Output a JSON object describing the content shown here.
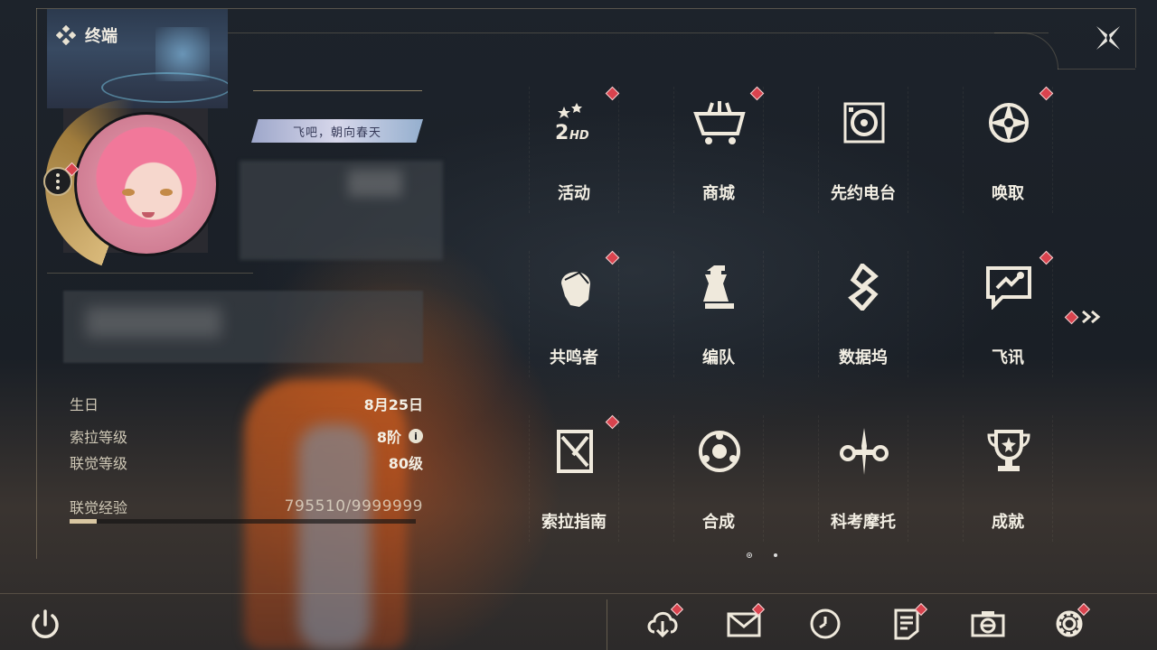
{
  "header": {
    "title": "终端"
  },
  "profile": {
    "signature": "飞吧，朝向春天",
    "info": [
      {
        "label": "生日",
        "value": "8月25日"
      },
      {
        "label": "索拉等级",
        "value": "8阶"
      },
      {
        "label": "联觉等级",
        "value": "80级"
      }
    ],
    "exp": {
      "label": "联觉经验",
      "value": "795510/9999999",
      "progress": 0.0796
    }
  },
  "grid": {
    "tiles": [
      {
        "label": "活动",
        "icon": "event-2hd-icon",
        "badge": true
      },
      {
        "label": "商城",
        "icon": "shop-cart-icon",
        "badge": true
      },
      {
        "label": "先约电台",
        "icon": "radio-turntable-icon",
        "badge": false
      },
      {
        "label": "唤取",
        "icon": "convene-star-icon",
        "badge": true
      },
      {
        "label": "共鸣者",
        "icon": "resonator-head-icon",
        "badge": true
      },
      {
        "label": "编队",
        "icon": "chess-team-icon",
        "badge": false
      },
      {
        "label": "数据坞",
        "icon": "data-dock-icon",
        "badge": false
      },
      {
        "label": "飞讯",
        "icon": "message-chat-icon",
        "badge": true
      },
      {
        "label": "索拉指南",
        "icon": "guide-book-icon",
        "badge": true
      },
      {
        "label": "合成",
        "icon": "synthesis-circle-icon",
        "badge": false
      },
      {
        "label": "科考摩托",
        "icon": "motorcycle-icon",
        "badge": false
      },
      {
        "label": "成就",
        "icon": "trophy-icon",
        "badge": false
      }
    ],
    "page": {
      "current": 1,
      "total": 2
    }
  },
  "bottom_bar": [
    {
      "name": "download",
      "icon": "cloud-download-icon",
      "badge": true
    },
    {
      "name": "mail",
      "icon": "mail-icon",
      "badge": true
    },
    {
      "name": "clock",
      "icon": "clock-icon",
      "badge": false
    },
    {
      "name": "notice",
      "icon": "notice-doc-icon",
      "badge": true
    },
    {
      "name": "camera",
      "icon": "camera-icon",
      "badge": false
    },
    {
      "name": "settings",
      "icon": "gear-icon",
      "badge": true
    }
  ],
  "colors": {
    "accent": "#d9c7a2",
    "badge": "#d9434e",
    "text": "#f3efe4"
  }
}
